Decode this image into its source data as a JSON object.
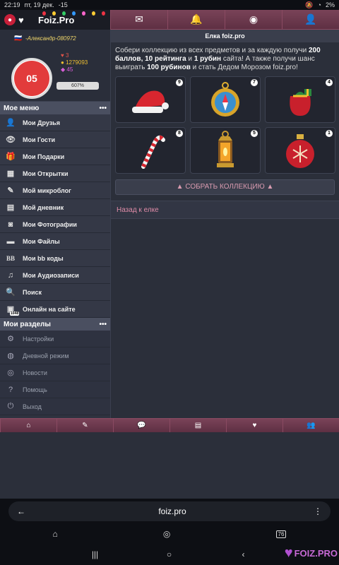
{
  "status": {
    "time": "22:19",
    "date": "пт, 19 дек.",
    "temp": "-15",
    "battery": "2%"
  },
  "logo": {
    "text": "Foiz.Pro"
  },
  "profile": {
    "name": "-Александр-080972",
    "stat1": "3",
    "stat2": "1279093",
    "stat3": "45",
    "progress": "607%"
  },
  "sidebar": {
    "section1": "Мое меню",
    "section2": "Мои разделы",
    "items": [
      {
        "label": "Мои Друзья",
        "icon": "users-icon"
      },
      {
        "label": "Мои Гости",
        "icon": "eye-icon"
      },
      {
        "label": "Мои Подарки",
        "icon": "gift-icon"
      },
      {
        "label": "Мои Открытки",
        "icon": "grid-icon"
      },
      {
        "label": "Мой микроблог",
        "icon": "edit-icon"
      },
      {
        "label": "Мой дневник",
        "icon": "book-icon"
      },
      {
        "label": "Мои Фотографии",
        "icon": "camera-icon"
      },
      {
        "label": "Мои Файлы",
        "icon": "folder-icon"
      },
      {
        "label": "Мои bb коды",
        "icon": "bb-icon"
      },
      {
        "label": "Мои Аудиозаписи",
        "icon": "music-icon"
      },
      {
        "label": "Поиск",
        "icon": "search-icon"
      },
      {
        "label": "Онлайн на сайте",
        "icon": "online-icon",
        "badge": "1048"
      }
    ],
    "items2": [
      {
        "label": "Настройки",
        "icon": "gear-icon"
      },
      {
        "label": "Дневной режим",
        "icon": "globe-icon"
      },
      {
        "label": "Новости",
        "icon": "news-icon"
      },
      {
        "label": "Помощь",
        "icon": "help-icon"
      },
      {
        "label": "Выход",
        "icon": "power-icon"
      }
    ]
  },
  "main": {
    "title": "Елка foiz.pro",
    "desc_1": "Собери коллекцию из всех предметов и за каждую получи",
    "desc_b1": "200 баллов, 10 рейтинга",
    "desc_2": " и ",
    "desc_b2": "1 рубин",
    "desc_3": " сайта! А также получи шанс выиграть ",
    "desc_b3": "100 рубинов",
    "desc_4": " и стать Дедом Морозом foiz.pro!",
    "items": [
      {
        "name": "santa-hat",
        "count": "9"
      },
      {
        "name": "compass",
        "count": "7"
      },
      {
        "name": "gift-bag",
        "count": "4"
      },
      {
        "name": "candy-cane",
        "count": "8"
      },
      {
        "name": "lantern",
        "count": "5"
      },
      {
        "name": "ornament",
        "count": "1"
      }
    ],
    "collect_button": "СОБРАТЬ КОЛЛЕКЦИЮ",
    "back_link": "Назад к елке"
  },
  "browser": {
    "url": "foiz.pro",
    "tabs": "76"
  },
  "watermark": "FOIZ.PRO"
}
